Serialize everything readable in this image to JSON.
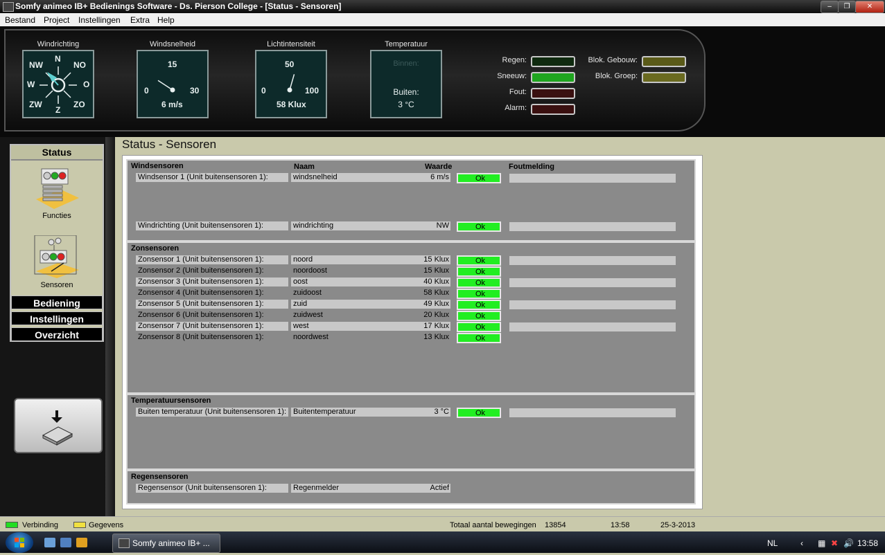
{
  "window": {
    "title": "Somfy animeo IB+ Bedienings Software - Ds. Pierson College  - [Status - Sensoren]"
  },
  "menu": [
    "Bestand",
    "Project",
    "Instellingen",
    "Extra",
    "Help"
  ],
  "gauges": {
    "wind_direction": {
      "label": "Windrichting",
      "n": "N",
      "no": "NO",
      "o": "O",
      "zo": "ZO",
      "z": "Z",
      "zw": "ZW",
      "w": "W",
      "nw": "NW"
    },
    "wind_speed": {
      "label": "Windsnelheid",
      "max": "15",
      "min": "0",
      "right": "30",
      "value": "6 m/s",
      "fraction": 0.4
    },
    "light": {
      "label": "Lichtintensiteit",
      "max": "50",
      "min": "0",
      "right": "100",
      "value": "58 Klux",
      "fraction": 0.58
    },
    "temperature": {
      "label": "Temperatuur",
      "inside_label": "Binnen:",
      "outside_label": "Buiten:",
      "value": "3 °C"
    }
  },
  "indicators": {
    "left": [
      {
        "label": "Regen:",
        "color": "#0f2a0f"
      },
      {
        "label": "Sneeuw:",
        "color": "#1fa51f"
      },
      {
        "label": "Fout:",
        "color": "#3a1010"
      },
      {
        "label": "Alarm:",
        "color": "#3a1010"
      }
    ],
    "right": [
      {
        "label": "Blok. Gebouw:",
        "color": "#5a5a18"
      },
      {
        "label": "Blok. Groep:",
        "color": "#6a6a20"
      }
    ]
  },
  "nav": {
    "status": "Status",
    "functies": "Functies",
    "sensoren": "Sensoren",
    "bediening": "Bediening",
    "instellingen": "Instellingen",
    "overzicht": "Overzicht"
  },
  "page": {
    "title": "Status - Sensoren"
  },
  "columns": {
    "naam": "Naam",
    "waarde": "Waarde",
    "foutmelding": "Foutmelding"
  },
  "sections": {
    "wind": {
      "title": "Windsensoren",
      "rows": [
        {
          "label": "Windsensor 1 (Unit buitensensoren 1):",
          "name": "windsnelheid",
          "value": "6 m/s",
          "status": "Ok"
        },
        {
          "label": "Windrichting (Unit buitensensoren 1):",
          "name": "windrichting",
          "value": "NW",
          "status": "Ok"
        }
      ]
    },
    "zon": {
      "title": "Zonsensoren",
      "rows": [
        {
          "label": "Zonsensor 1 (Unit buitensensoren 1):",
          "name": "noord",
          "value": "15 Klux",
          "status": "Ok"
        },
        {
          "label": "Zonsensor 2 (Unit buitensensoren 1):",
          "name": "noordoost",
          "value": "15 Klux",
          "status": "Ok"
        },
        {
          "label": "Zonsensor 3 (Unit buitensensoren 1):",
          "name": "oost",
          "value": "40 Klux",
          "status": "Ok"
        },
        {
          "label": "Zonsensor 4 (Unit buitensensoren 1):",
          "name": "zuidoost",
          "value": "58 Klux",
          "status": "Ok"
        },
        {
          "label": "Zonsensor 5 (Unit buitensensoren 1):",
          "name": "zuid",
          "value": "49 Klux",
          "status": "Ok"
        },
        {
          "label": "Zonsensor 6 (Unit buitensensoren 1):",
          "name": "zuidwest",
          "value": "20 Klux",
          "status": "Ok"
        },
        {
          "label": "Zonsensor 7 (Unit buitensensoren 1):",
          "name": "west",
          "value": "17 Klux",
          "status": "Ok"
        },
        {
          "label": "Zonsensor 8 (Unit buitensensoren 1):",
          "name": "noordwest",
          "value": "13 Klux",
          "status": "Ok"
        }
      ]
    },
    "temp": {
      "title": "Temperatuursensoren",
      "rows": [
        {
          "label": "Buiten temperatuur (Unit buitensensoren 1):",
          "name": "Buitentemperatuur",
          "value": "3 °C",
          "status": "Ok"
        }
      ]
    },
    "regen": {
      "title": "Regensensoren",
      "rows": [
        {
          "label": "Regensensor (Unit buitensensoren 1):",
          "name": "Regenmelder",
          "value": "Actief"
        }
      ]
    }
  },
  "statusbar": {
    "verbinding": "Verbinding",
    "gegevens": "Gegevens",
    "total_label": "Totaal aantal bewegingen",
    "total_value": "13854",
    "time": "13:58",
    "date": "25-3-2013"
  },
  "taskbar": {
    "app": "Somfy animeo IB+ ...",
    "lang": "NL",
    "clock": "13:58"
  }
}
